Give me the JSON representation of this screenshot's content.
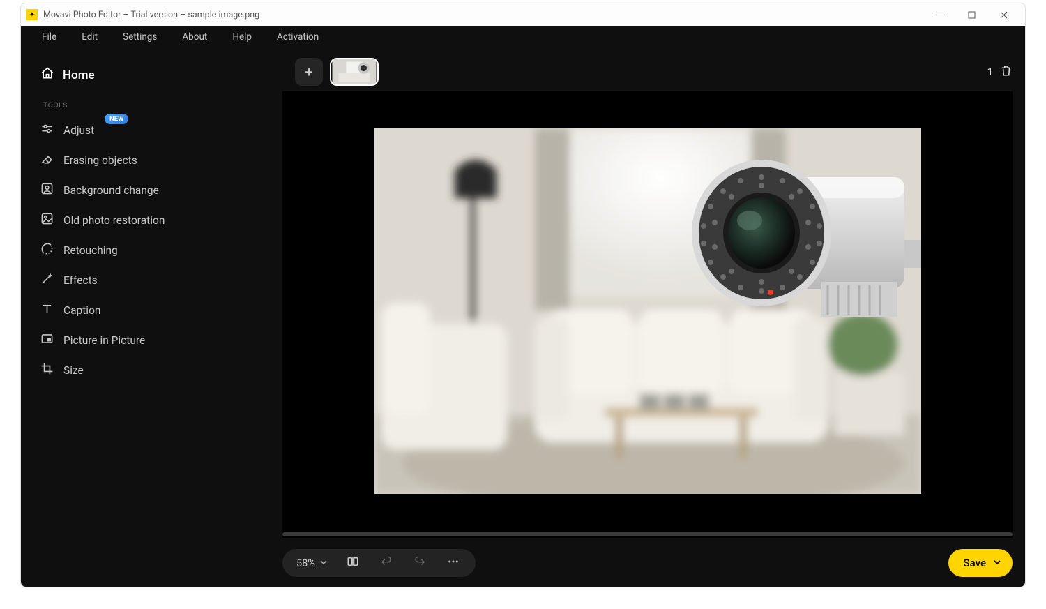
{
  "window": {
    "title": "Movavi Photo Editor – Trial version – sample image.png"
  },
  "menu": {
    "items": [
      "File",
      "Edit",
      "Settings",
      "About",
      "Help",
      "Activation"
    ]
  },
  "sidebar": {
    "home_label": "Home",
    "section_label": "TOOLS",
    "new_badge": "NEW",
    "tools": [
      {
        "label": "Adjust",
        "icon": "adjust",
        "new": true
      },
      {
        "label": "Erasing objects",
        "icon": "eraser",
        "new": false
      },
      {
        "label": "Background change",
        "icon": "person-frame",
        "new": false
      },
      {
        "label": "Old photo restoration",
        "icon": "image-repair",
        "new": false
      },
      {
        "label": "Retouching",
        "icon": "retouch",
        "new": false
      },
      {
        "label": "Effects",
        "icon": "wand",
        "new": false
      },
      {
        "label": "Caption",
        "icon": "text",
        "new": false
      },
      {
        "label": "Picture in Picture",
        "icon": "pip",
        "new": false
      },
      {
        "label": "Size",
        "icon": "crop",
        "new": false
      }
    ]
  },
  "thumbs": {
    "count": "1"
  },
  "toolbar": {
    "zoom": "58%",
    "save_label": "Save"
  }
}
